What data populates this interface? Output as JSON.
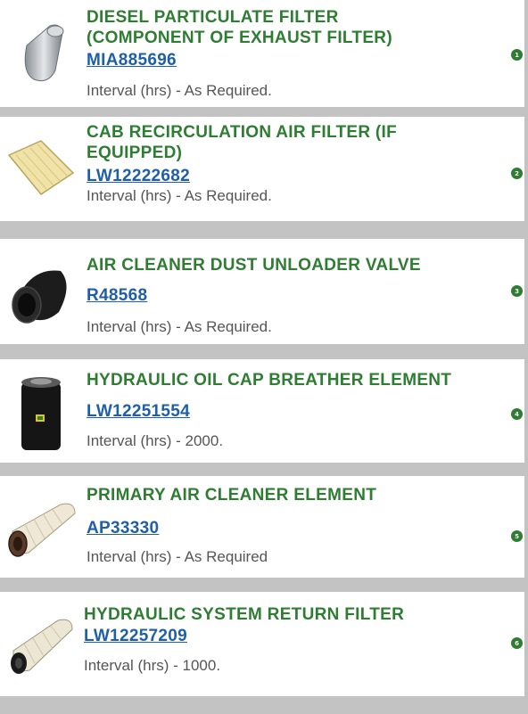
{
  "items": [
    {
      "title_line1": "DIESEL PARTICULATE FILTER",
      "title_line2": "(COMPONENT OF EXHAUST FILTER)",
      "part": "MIA885696",
      "interval": "Interval (hrs) - As Required.",
      "badge": "1",
      "icon": "dpf-filter-icon"
    },
    {
      "title_line1": "CAB RECIRCULATION AIR FILTER (IF",
      "title_line2": "EQUIPPED)",
      "part": "LW12222682",
      "interval": "Interval (hrs) - As Required.",
      "badge": "2",
      "icon": "cab-air-filter-icon"
    },
    {
      "title_line1": "AIR CLEANER DUST UNLOADER VALVE",
      "part": "R48568",
      "interval": "Interval (hrs) - As Required.",
      "badge": "3",
      "icon": "dust-valve-icon"
    },
    {
      "title_line1": "HYDRAULIC OIL CAP BREATHER ELEMENT",
      "part": "LW12251554",
      "interval": "Interval (hrs) - 2000.",
      "badge": "4",
      "icon": "breather-filter-icon"
    },
    {
      "title_line1": "PRIMARY AIR CLEANER ELEMENT",
      "part": "AP33330",
      "interval": "Interval (hrs) - As Required",
      "badge": "5",
      "icon": "air-cleaner-element-icon"
    },
    {
      "title_line1": "HYDRAULIC SYSTEM RETURN FILTER",
      "part": "LW12257209",
      "interval": "Interval (hrs) - 1000.",
      "badge": "6",
      "icon": "return-filter-icon"
    }
  ]
}
